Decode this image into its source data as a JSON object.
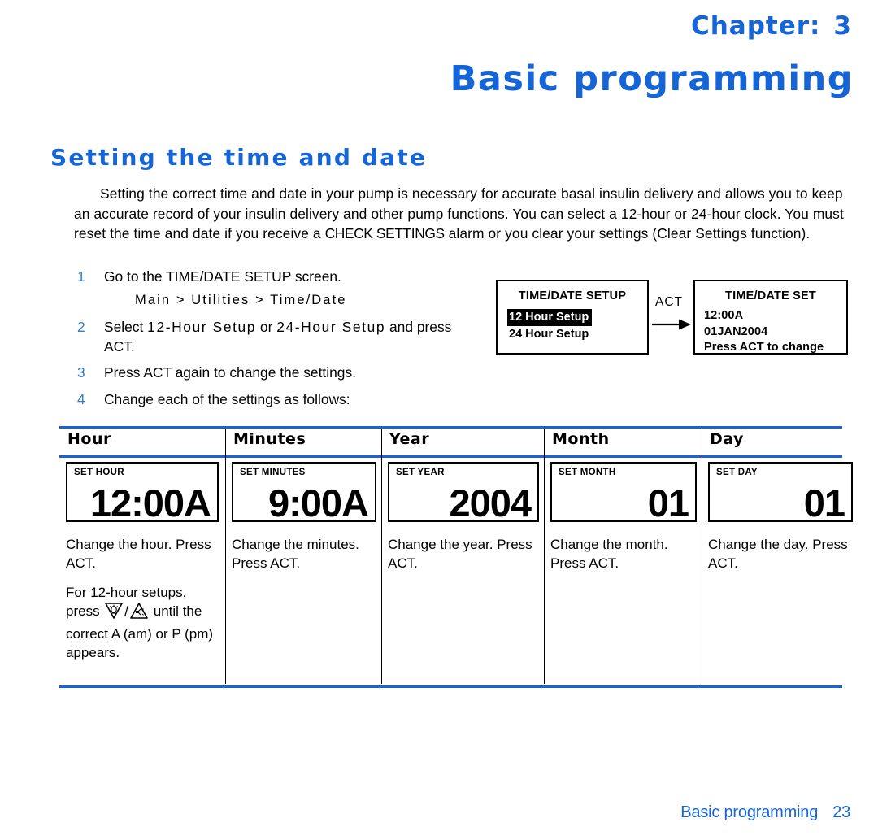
{
  "header": {
    "chapter_label": "Chapter:",
    "chapter_number": "3",
    "chapter_title": "Basic programming"
  },
  "section": {
    "heading": "Setting the time and date",
    "intro_part1": "Setting the correct time and date in your pump is necessary for accurate basal insulin delivery and allows you to keep an accurate record of your insulin delivery and other pump functions. You can select a 12-hour or 24-hour clock. You must reset the time and date if you receive a ",
    "intro_alarm": "CHECK SETTINGS",
    "intro_part2": " alarm or you clear your settings (Clear Settings function)."
  },
  "steps": [
    {
      "num": "1",
      "text": "Go to the TIME/DATE SETUP screen.",
      "path": "Main > Utilities > Time/Date"
    },
    {
      "num": "2",
      "text_pre": "Select ",
      "text_opt1": "12-Hour Setup",
      "text_mid": " or ",
      "text_opt2": "24-Hour Setup",
      "text_post": " and press ACT."
    },
    {
      "num": "3",
      "text": "Press ACT again to change the settings."
    },
    {
      "num": "4",
      "text": "Change each of the settings as follows:"
    }
  ],
  "diagram": {
    "screen1": {
      "title": "TIME/DATE SETUP",
      "items": [
        {
          "label": "12 Hour Setup",
          "selected": true
        },
        {
          "label": "24 Hour Setup",
          "selected": false
        }
      ]
    },
    "arrow_label": "ACT",
    "arrow_icon": "right-arrow-icon",
    "screen2": {
      "title": "TIME/DATE SET",
      "lines": [
        "12:00A",
        "01JAN2004",
        "Press ACT to change"
      ]
    }
  },
  "table": {
    "columns": [
      {
        "header": "Hour",
        "screen_label": "SET HOUR",
        "screen_value": "12:00A",
        "paragraphs": [
          "Change the hour. Press ACT.",
          "For 12-hour setups, press ",
          "the correct A (am) or P (pm) appears."
        ],
        "has_buttons": true,
        "button_down_icon": "down-triangle-icon",
        "button_separator": "/",
        "button_up_icon": "up-triangle-icon",
        "after_buttons": " until"
      },
      {
        "header": "Minutes",
        "screen_label": "SET MINUTES",
        "screen_value": "9:00A",
        "paragraphs": [
          "Change the minutes. Press ACT."
        ],
        "has_buttons": false
      },
      {
        "header": "Year",
        "screen_label": "SET YEAR",
        "screen_value": "2004",
        "paragraphs": [
          "Change the year. Press ACT."
        ],
        "has_buttons": false
      },
      {
        "header": "Month",
        "screen_label": "SET MONTH",
        "screen_value": "01",
        "paragraphs": [
          "Change the month. Press ACT."
        ],
        "has_buttons": false
      },
      {
        "header": "Day",
        "screen_label": "SET DAY",
        "screen_value": "01",
        "paragraphs": [
          "Change the day. Press ACT."
        ],
        "has_buttons": false
      }
    ]
  },
  "footer": {
    "text": "Basic programming",
    "page_number": "23"
  },
  "colors": {
    "accent_blue": "#1565d8",
    "step_number_blue": "#2f7fd8"
  }
}
